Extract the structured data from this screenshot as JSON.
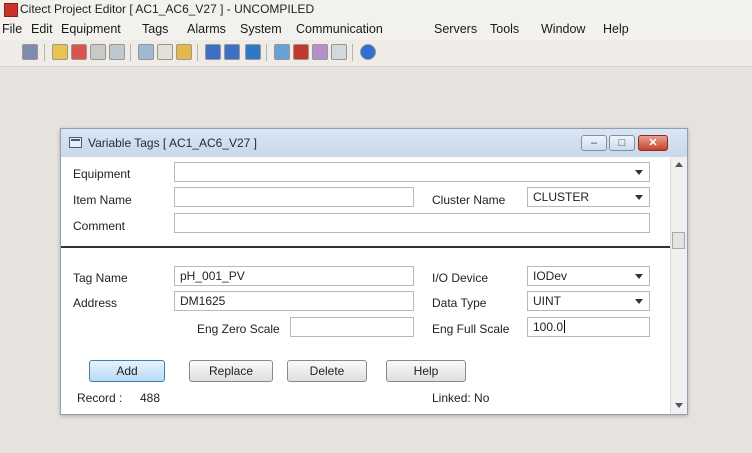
{
  "app": {
    "title": "Citect Project Editor [ AC1_AC6_V27 ] - UNCOMPILED"
  },
  "menubar": {
    "items": [
      "File",
      "Edit",
      "Equipment",
      "Tags",
      "Alarms",
      "System",
      "Communication",
      "Servers",
      "Tools",
      "Window",
      "Help"
    ]
  },
  "toolbar": {
    "icons": [
      "open-icon",
      "project-icon",
      "edit-icon",
      "copy-icon",
      "pack-icon",
      "cut-icon",
      "paste-icon",
      "folder-icon",
      "back-icon",
      "forward-icon",
      "list-icon",
      "table-icon",
      "wand-icon",
      "compile-icon",
      "view-icon",
      "help-icon"
    ]
  },
  "window": {
    "title": "Variable Tags [ AC1_AC6_V27 ]",
    "controls": {
      "minimize": "–",
      "maximize": "□",
      "close": "✕"
    }
  },
  "form": {
    "equipment_label": "Equipment",
    "equipment_value": "",
    "item_name_label": "Item Name",
    "item_name_value": "",
    "cluster_name_label": "Cluster Name",
    "cluster_name_value": "CLUSTER",
    "comment_label": "Comment",
    "comment_value": "",
    "tag_name_label": "Tag Name",
    "tag_name_value": "pH_001_PV",
    "io_device_label": "I/O Device",
    "io_device_value": "IODev",
    "address_label": "Address",
    "address_value": "DM1625",
    "data_type_label": "Data Type",
    "data_type_value": "UINT",
    "eng_zero_scale_label": "Eng Zero Scale",
    "eng_zero_scale_value": "",
    "eng_full_scale_label": "Eng Full Scale",
    "eng_full_scale_value": "100.0"
  },
  "buttons": {
    "add": "Add",
    "replace": "Replace",
    "delete": "Delete",
    "help": "Help"
  },
  "status": {
    "record_label": "Record :",
    "record_value": "488",
    "linked": "Linked: No"
  }
}
